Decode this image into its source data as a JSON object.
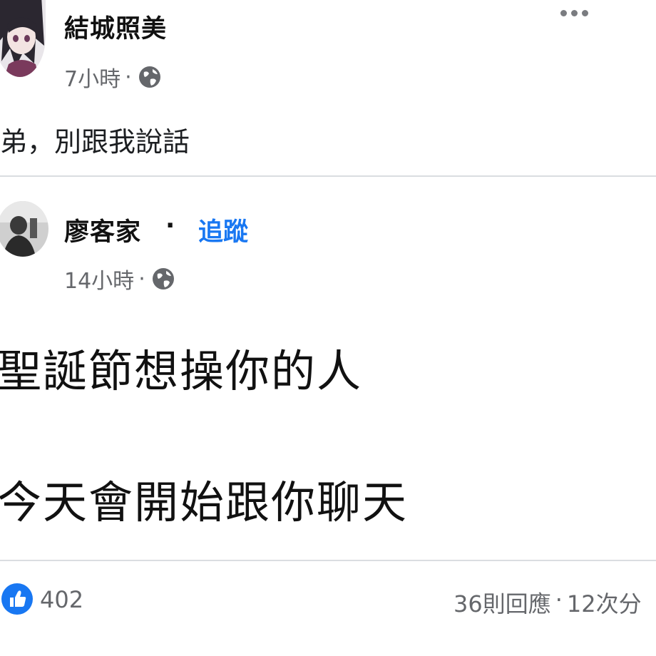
{
  "original_post": {
    "author": "結城照美",
    "time": "7小時",
    "separator": "·",
    "body": "弟，別跟我說話",
    "privacy_icon": "globe-icon",
    "menu_icon": "more-options-icon"
  },
  "shared_post": {
    "author": "廖客家",
    "follow_separator": "·",
    "follow_label": "追蹤",
    "time": "14小時",
    "separator": "·",
    "privacy_icon": "globe-icon",
    "body_lines": [
      "聖誕節想操你的人",
      "今天會開始跟你聊天"
    ]
  },
  "footer": {
    "reaction_icon": "like-icon",
    "like_count": "402",
    "comments": "36則回應",
    "separator": "·",
    "shares": "12次分"
  },
  "colors": {
    "accent": "#1877f2",
    "meta_text": "#65676b",
    "divider": "#dadde1"
  }
}
